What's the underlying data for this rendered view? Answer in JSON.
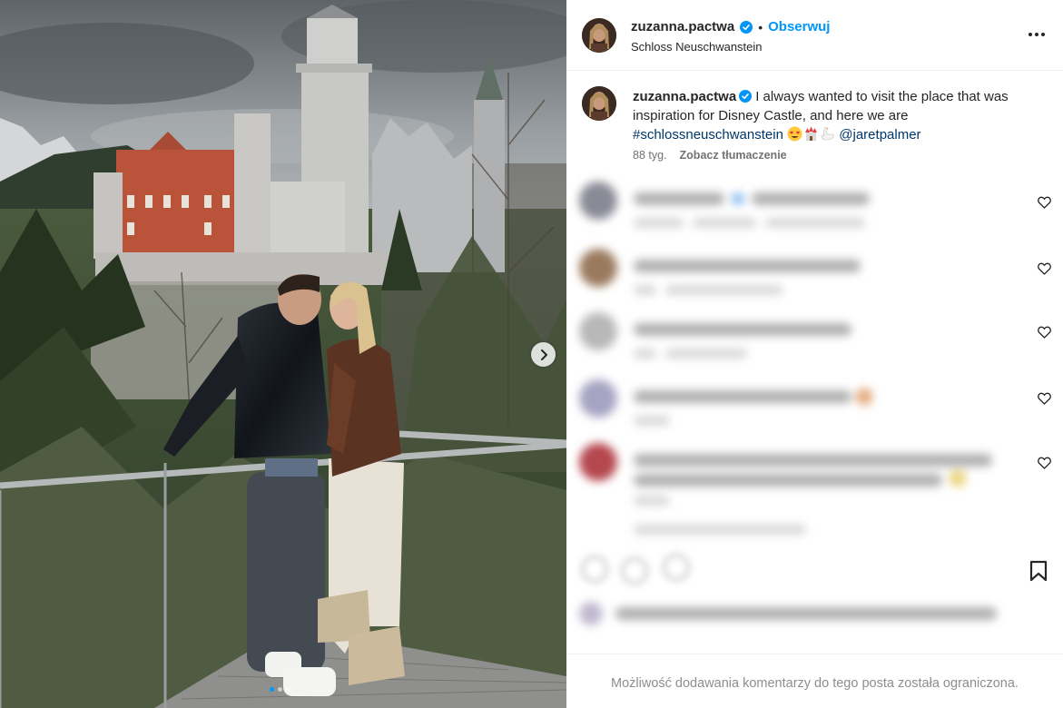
{
  "post": {
    "username": "zuzanna.pactwa",
    "follow_label": "Obserwuj",
    "separator": "•",
    "location": "Schloss Neuschwanstein",
    "caption_username": "zuzanna.pactwa",
    "caption_text": "I always wanted to visit the place that was inspiration for Disney Castle, and here we are",
    "hashtag": "#schlossneuschwanstein",
    "emoji_icons": [
      "heart-eyes-emoji",
      "castle-emoji",
      "swan-emoji"
    ],
    "mention": "@jaretpalmer",
    "time_ago": "88 tyg.",
    "translate_label": "Zobacz tłumaczenie",
    "comments_restricted": "Możliwość dodawania komentarzy do tego posta została ograniczona."
  },
  "carousel": {
    "current_index": 1,
    "dot_count": 3
  },
  "colors": {
    "accent": "#0095f6",
    "link": "#00376b",
    "text": "#262626",
    "muted": "#737373"
  },
  "icons": [
    "verified-badge-icon",
    "more-options-icon",
    "next-arrow-icon",
    "heart-icon",
    "bookmark-icon"
  ]
}
